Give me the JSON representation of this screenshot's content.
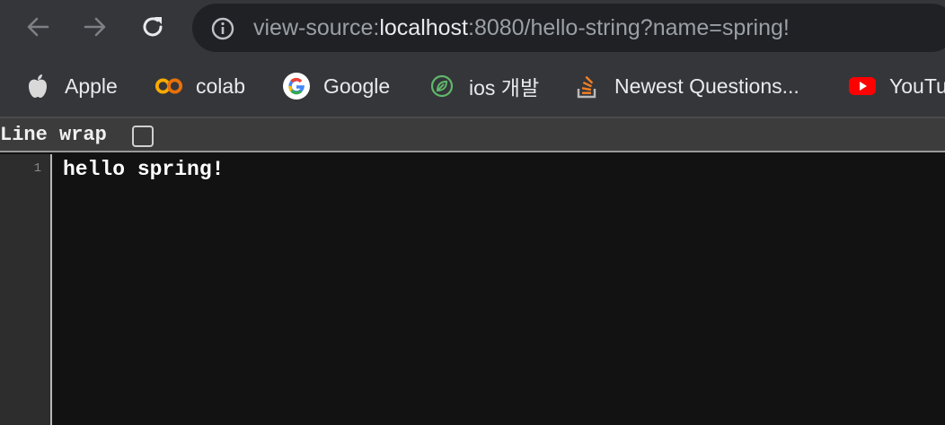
{
  "toolbar": {
    "url_scheme": "view-source:",
    "url_host": "localhost",
    "url_rest": ":8080/hello-string?name=spring!"
  },
  "bookmarks": [
    {
      "label": "Apple",
      "icon": "apple-icon"
    },
    {
      "label": "colab",
      "icon": "colab-icon"
    },
    {
      "label": "Google",
      "icon": "google-icon"
    },
    {
      "label": "ios 개발",
      "icon": "leaf-icon"
    },
    {
      "label": "Newest Questions...",
      "icon": "stackoverflow-icon"
    },
    {
      "label": "YouTube",
      "icon": "youtube-icon"
    }
  ],
  "viewer": {
    "line_wrap_label": "Line wrap",
    "line_wrap_checked": false,
    "lines": [
      {
        "number": "1",
        "text": "hello spring!"
      }
    ]
  },
  "colors": {
    "toolbar_bg": "#35363a",
    "omnibox_bg": "#202124",
    "page_bg": "#121212",
    "youtube_red": "#ff0000",
    "colab_orange": "#f9ab00"
  }
}
